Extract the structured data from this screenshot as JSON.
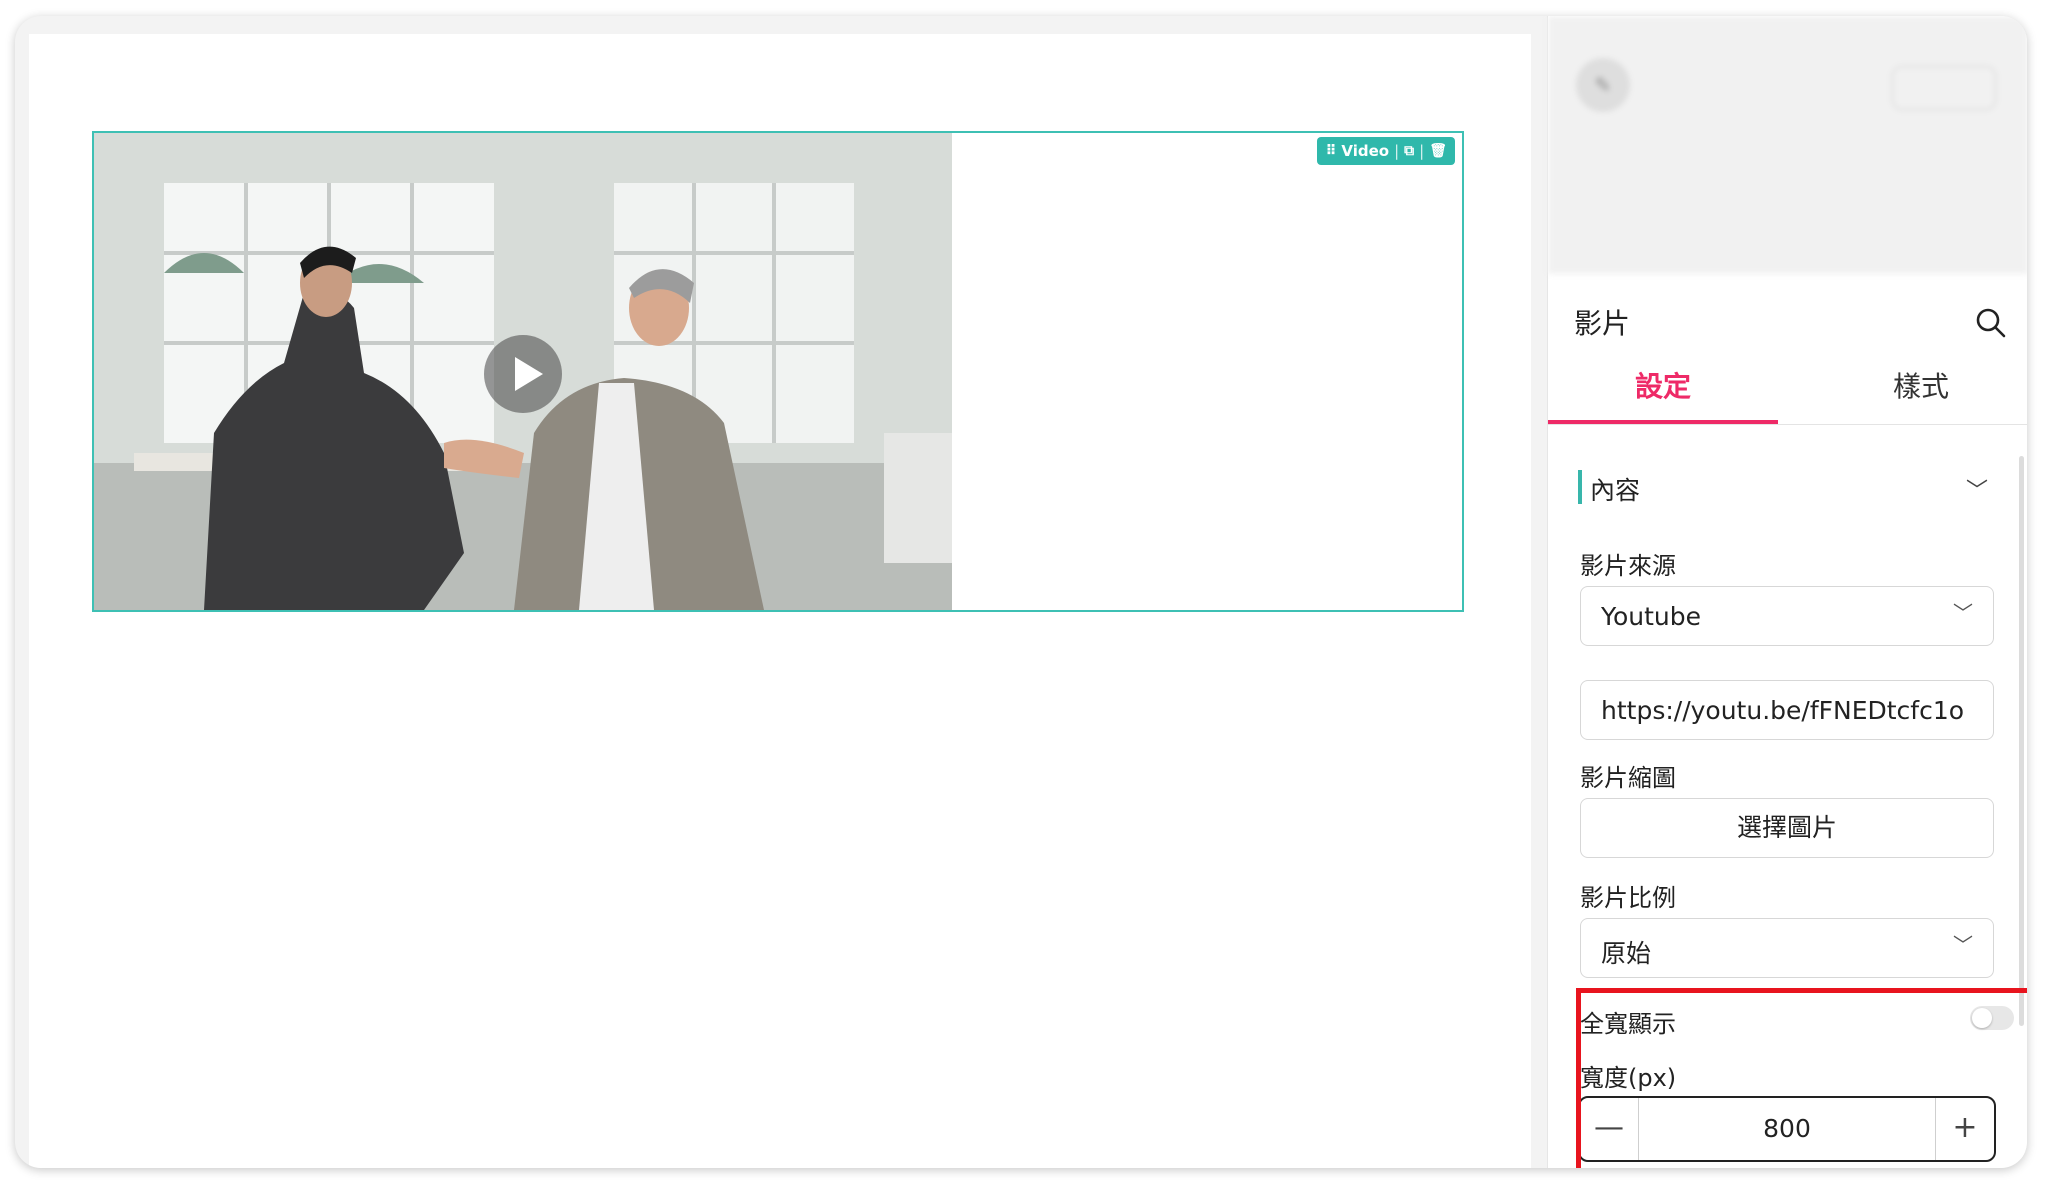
{
  "editor": {
    "video_block": {
      "toolbar_label": "Video",
      "drag_icon": "drag-handle-icon",
      "duplicate_icon": "duplicate-icon",
      "delete_icon": "trash-icon",
      "accent_color": "#2fb8ab",
      "play_icon": "play-icon"
    }
  },
  "panel": {
    "title": "影片",
    "search_icon": "search-icon",
    "tabs": [
      {
        "label": "設定",
        "active": true
      },
      {
        "label": "樣式",
        "active": false
      }
    ],
    "accent_color": "#ee2a67",
    "section": {
      "label": "內容",
      "chevron_icon": "chevron-down-icon"
    },
    "fields": {
      "source_label": "影片來源",
      "source_value": "Youtube",
      "url_value": "https://youtu.be/fFNEDtcfc1o",
      "thumbnail_label": "影片縮圖",
      "thumbnail_button": "選擇圖片",
      "ratio_label": "影片比例",
      "ratio_value": "原始",
      "fullwidth_label": "全寬顯示",
      "fullwidth_on": false,
      "width_label": "寬度(px)",
      "width_value": "800",
      "minus_symbol": "—",
      "plus_symbol": "+"
    }
  }
}
